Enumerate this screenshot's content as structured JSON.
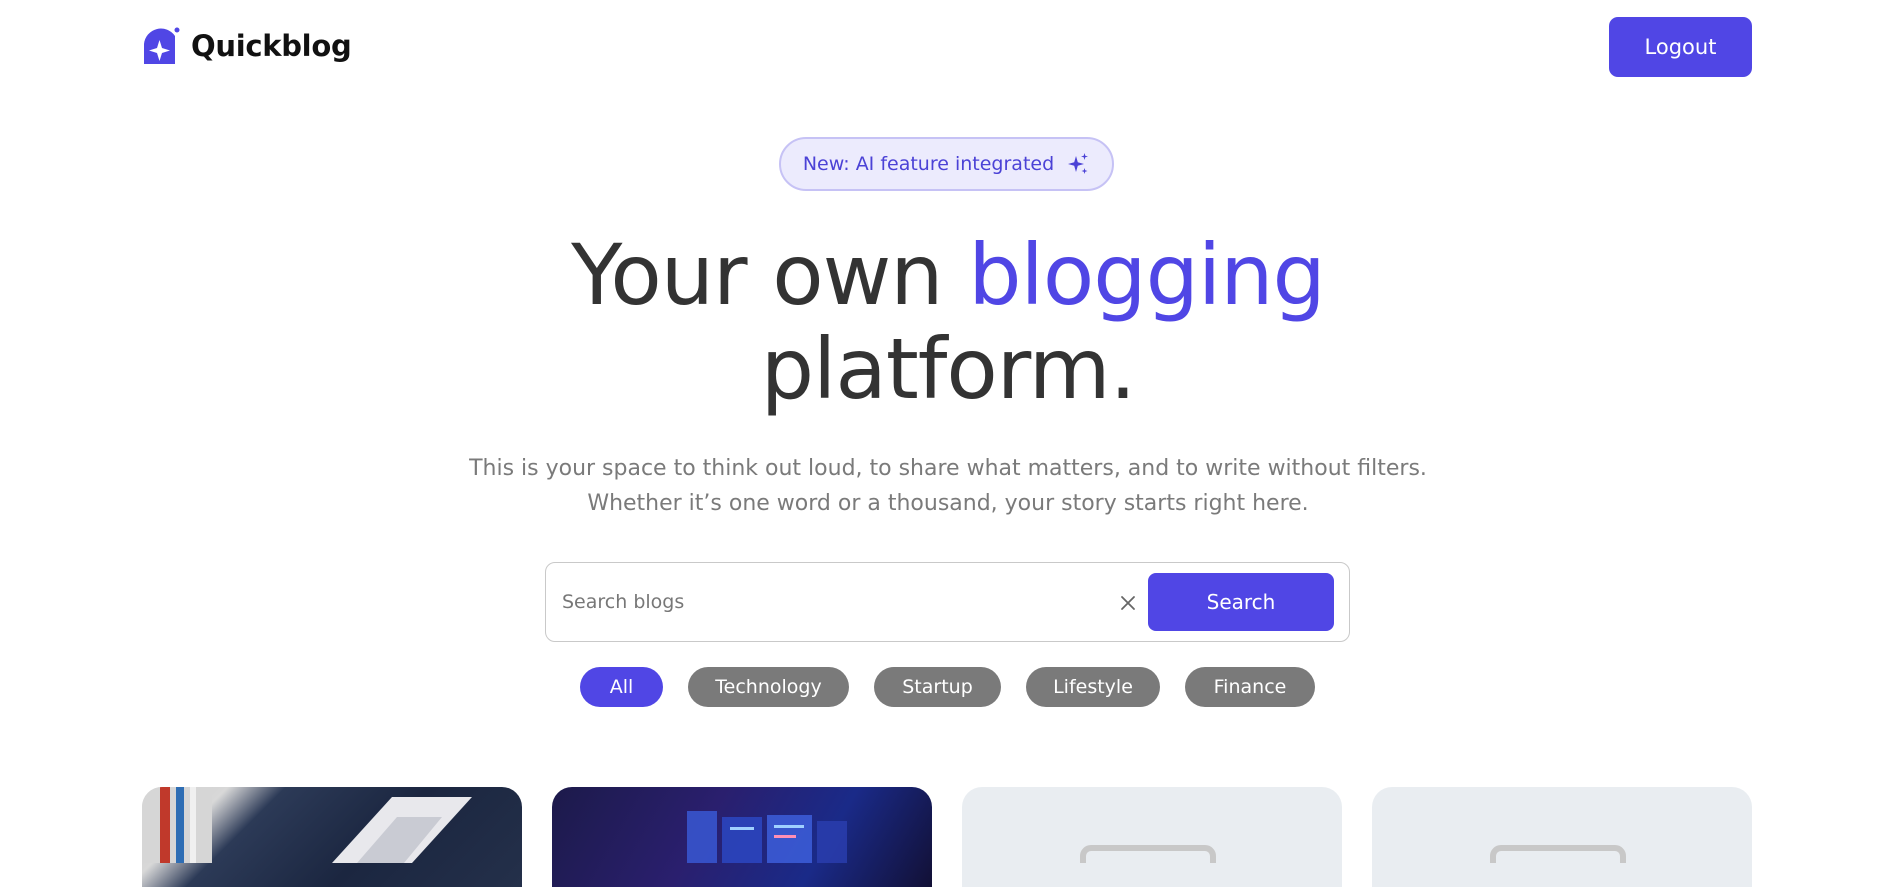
{
  "brand": {
    "name": "Quickblog",
    "logo_icon": "quickblog-logo-icon",
    "accent_color": "#5046e5"
  },
  "header": {
    "logout_label": "Logout"
  },
  "badge": {
    "text": "New: AI feature integrated",
    "icon": "sparkles-icon"
  },
  "hero": {
    "title_part1": "Your own",
    "title_accent": "blogging",
    "title_part2": "platform.",
    "subtitle_line1": "This is your space to think out loud, to share what matters, and to write without filters.",
    "subtitle_line2": "Whether it’s one word or a thousand, your story starts right here."
  },
  "search": {
    "placeholder": "Search blogs",
    "value": "",
    "clear_icon": "close-icon",
    "button_label": "Search"
  },
  "categories": [
    {
      "label": "All",
      "active": true
    },
    {
      "label": "Technology",
      "active": false
    },
    {
      "label": "Startup",
      "active": false
    },
    {
      "label": "Lifestyle",
      "active": false
    },
    {
      "label": "Finance",
      "active": false
    }
  ],
  "cards": [
    {
      "image": "person-holding-document-image"
    },
    {
      "image": "digital-dashboard-screens-image"
    },
    {
      "image": "placeholder-image-icon"
    },
    {
      "image": "placeholder-image-icon"
    }
  ]
}
